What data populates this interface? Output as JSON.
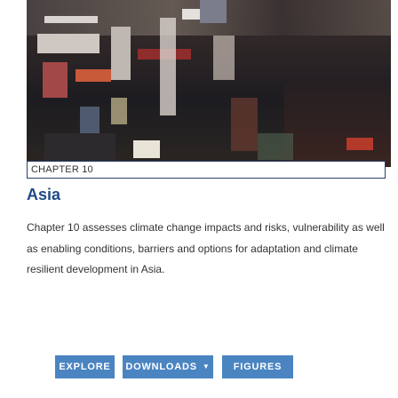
{
  "card": {
    "image_alt": "climate-related street scene",
    "chapter_label": "CHAPTER 10",
    "title": "Asia",
    "description": "Chapter 10 assesses climate change impacts and risks, vulnerability as well as enabling conditions, barriers and options for adaptation and climate resilient development in Asia."
  },
  "buttons": {
    "explore": "EXPLORE",
    "downloads": "DOWNLOADS",
    "downloads_caret": "▼",
    "figures": "FIGURES"
  },
  "colors": {
    "accent": "#4a84c1",
    "title": "#1e4a86",
    "border": "#2b3f6b"
  }
}
